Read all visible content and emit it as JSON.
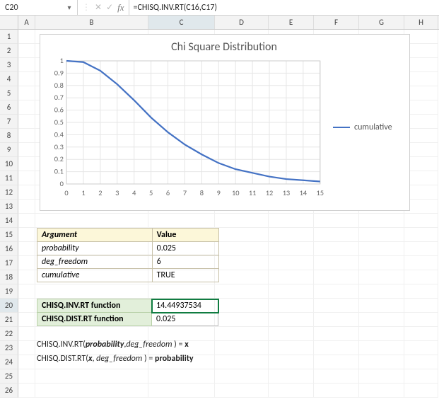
{
  "name_box": "C20",
  "formula": "=CHISQ.INV.RT(C16,C17)",
  "fx_label": "fx",
  "columns": [
    "A",
    "B",
    "C",
    "D",
    "E",
    "F",
    "G",
    "H"
  ],
  "row_count": 26,
  "selected_row": 20,
  "selected_col": "C",
  "arg_table": {
    "headers": {
      "arg": "Argument",
      "val": "Value"
    },
    "rows": [
      {
        "arg": "probability",
        "val": "0.025"
      },
      {
        "arg": "deg_freedom",
        "val": "6"
      },
      {
        "arg": "cumulative",
        "val": "TRUE"
      }
    ]
  },
  "results": [
    {
      "label": "CHISQ.INV.RT function",
      "value": "14.44937534",
      "active": true
    },
    {
      "label": "CHISQ.DIST.RT function",
      "value": "0.025",
      "active": false
    }
  ],
  "syntax": {
    "line1": {
      "fn": "CHISQ.INV.RT",
      "a1": "probability",
      "a2": "deg_freedom",
      "res": "x"
    },
    "line2": {
      "fn": "CHISQ.DIST.RT",
      "a1": "x",
      "a2": "deg_freedom",
      "res": "probability"
    }
  },
  "chart_data": {
    "type": "line",
    "title": "Chi Square Distribution",
    "xlabel": "",
    "ylabel": "",
    "xlim": [
      0,
      15
    ],
    "ylim": [
      0,
      1
    ],
    "xticks": [
      0,
      1,
      2,
      3,
      4,
      5,
      6,
      7,
      8,
      9,
      10,
      11,
      12,
      13,
      14,
      15
    ],
    "yticks": [
      0,
      0.1,
      0.2,
      0.3,
      0.4,
      0.5,
      0.6,
      0.7,
      0.8,
      0.9,
      1
    ],
    "legend_position": "right",
    "grid": true,
    "series": [
      {
        "name": "cumulative",
        "color": "#4472C4",
        "x": [
          0,
          1,
          2,
          3,
          4,
          5,
          6,
          7,
          8,
          9,
          10,
          11,
          12,
          13,
          14,
          15
        ],
        "y": [
          1.0,
          0.99,
          0.92,
          0.81,
          0.68,
          0.54,
          0.42,
          0.32,
          0.24,
          0.17,
          0.12,
          0.09,
          0.06,
          0.04,
          0.03,
          0.02
        ]
      }
    ]
  }
}
